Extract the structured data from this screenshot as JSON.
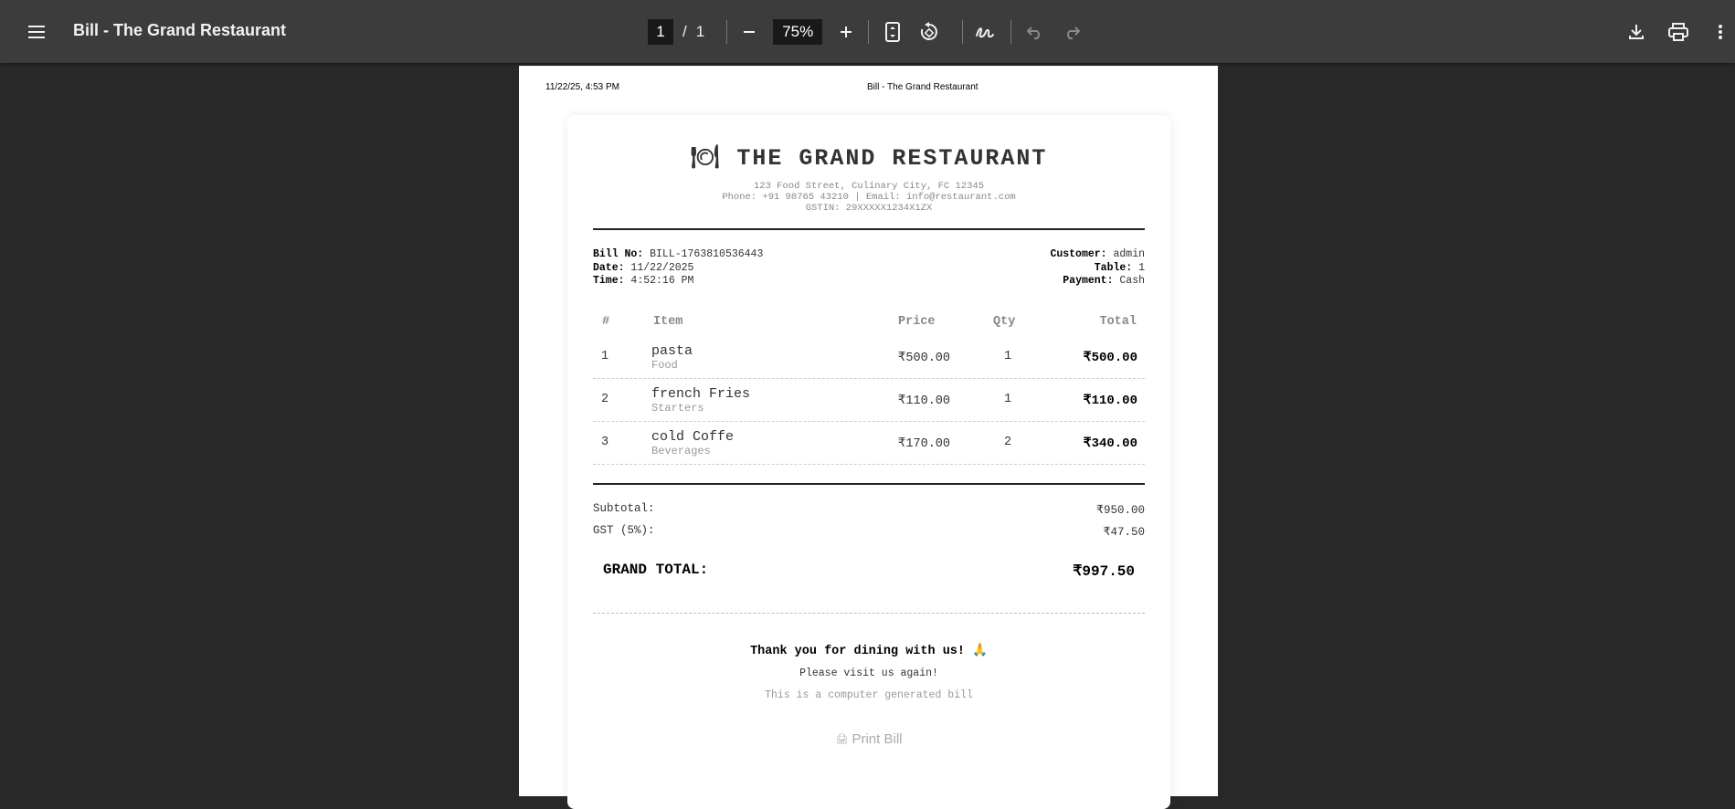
{
  "toolbar": {
    "title": "Bill - The Grand Restaurant",
    "page_current": "1",
    "page_sep": "/",
    "page_total": "1",
    "zoom": "75%"
  },
  "page_header": {
    "datetime": "11/22/25, 4:53 PM",
    "title": "Bill - The Grand Restaurant"
  },
  "restaurant": {
    "icon": "🍽",
    "name": "THE GRAND RESTAURANT",
    "address": "123 Food Street, Culinary City, FC 12345",
    "contact": "Phone: +91 98765 43210 | Email: info@restaurant.com",
    "gstin": "GSTIN: 29XXXXX1234X1ZX"
  },
  "bill_meta": {
    "bill_no_label": "Bill No:",
    "bill_no": "BILL-1763810536443",
    "date_label": "Date:",
    "date": "11/22/2025",
    "time_label": "Time:",
    "time": "4:52:16 PM",
    "customer_label": "Customer:",
    "customer": "admin",
    "table_label": "Table:",
    "table": "1",
    "payment_label": "Payment:",
    "payment": "Cash"
  },
  "table": {
    "headers": [
      "#",
      "Item",
      "Price",
      "Qty",
      "Total"
    ],
    "rows": [
      {
        "num": "1",
        "item": "pasta",
        "category": "Food",
        "price": "₹500.00",
        "qty": "1",
        "total": "₹500.00"
      },
      {
        "num": "2",
        "item": "french Fries",
        "category": "Starters",
        "price": "₹110.00",
        "qty": "1",
        "total": "₹110.00"
      },
      {
        "num": "3",
        "item": "cold Coffe",
        "category": "Beverages",
        "price": "₹170.00",
        "qty": "2",
        "total": "₹340.00"
      }
    ]
  },
  "summary": {
    "subtotal_label": "Subtotal:",
    "subtotal": "₹950.00",
    "gst_label": "GST (5%):",
    "gst": "₹47.50",
    "grand_label": "GRAND TOTAL:",
    "grand": "₹997.50"
  },
  "footer": {
    "thanks": "Thank you for dining with us! 🙏",
    "visit": "Please visit us again!",
    "generated": "This is a computer generated bill",
    "print_icon": "🖨",
    "print_label": "Print Bill"
  }
}
